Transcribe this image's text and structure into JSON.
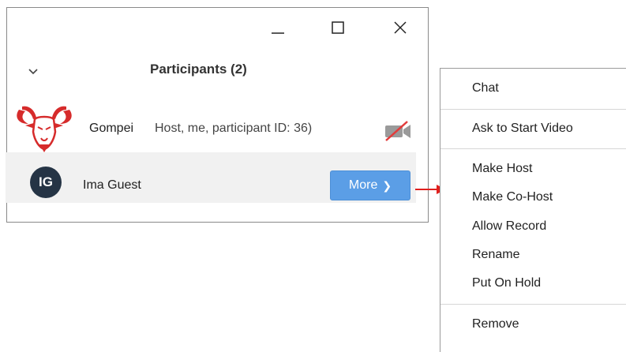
{
  "window": {
    "controls": {
      "minimize": "minimize-icon",
      "maximize": "maximize-icon",
      "close": "close-icon"
    }
  },
  "panel": {
    "title": "Participants (2)"
  },
  "participants": [
    {
      "name": "Gompei",
      "details": "Host, me, participant ID: 36)",
      "avatar": "goat-logo",
      "video": "video-off"
    },
    {
      "name": "Ima Guest",
      "initials": "IG",
      "more_label": "More"
    }
  ],
  "context_menu": {
    "items": [
      {
        "label": "Chat"
      },
      {
        "label": "Ask to Start Video"
      },
      {
        "label": "Make Host"
      },
      {
        "label": "Make Co-Host"
      },
      {
        "label": "Allow Record"
      },
      {
        "label": "Rename"
      },
      {
        "label": "Put On Hold"
      },
      {
        "label": "Remove"
      }
    ]
  },
  "colors": {
    "avatar_bg": "#253445",
    "more_button": "#5b9ee6",
    "annotation_arrow": "#e0201e",
    "goat_red": "#d62b2b"
  }
}
